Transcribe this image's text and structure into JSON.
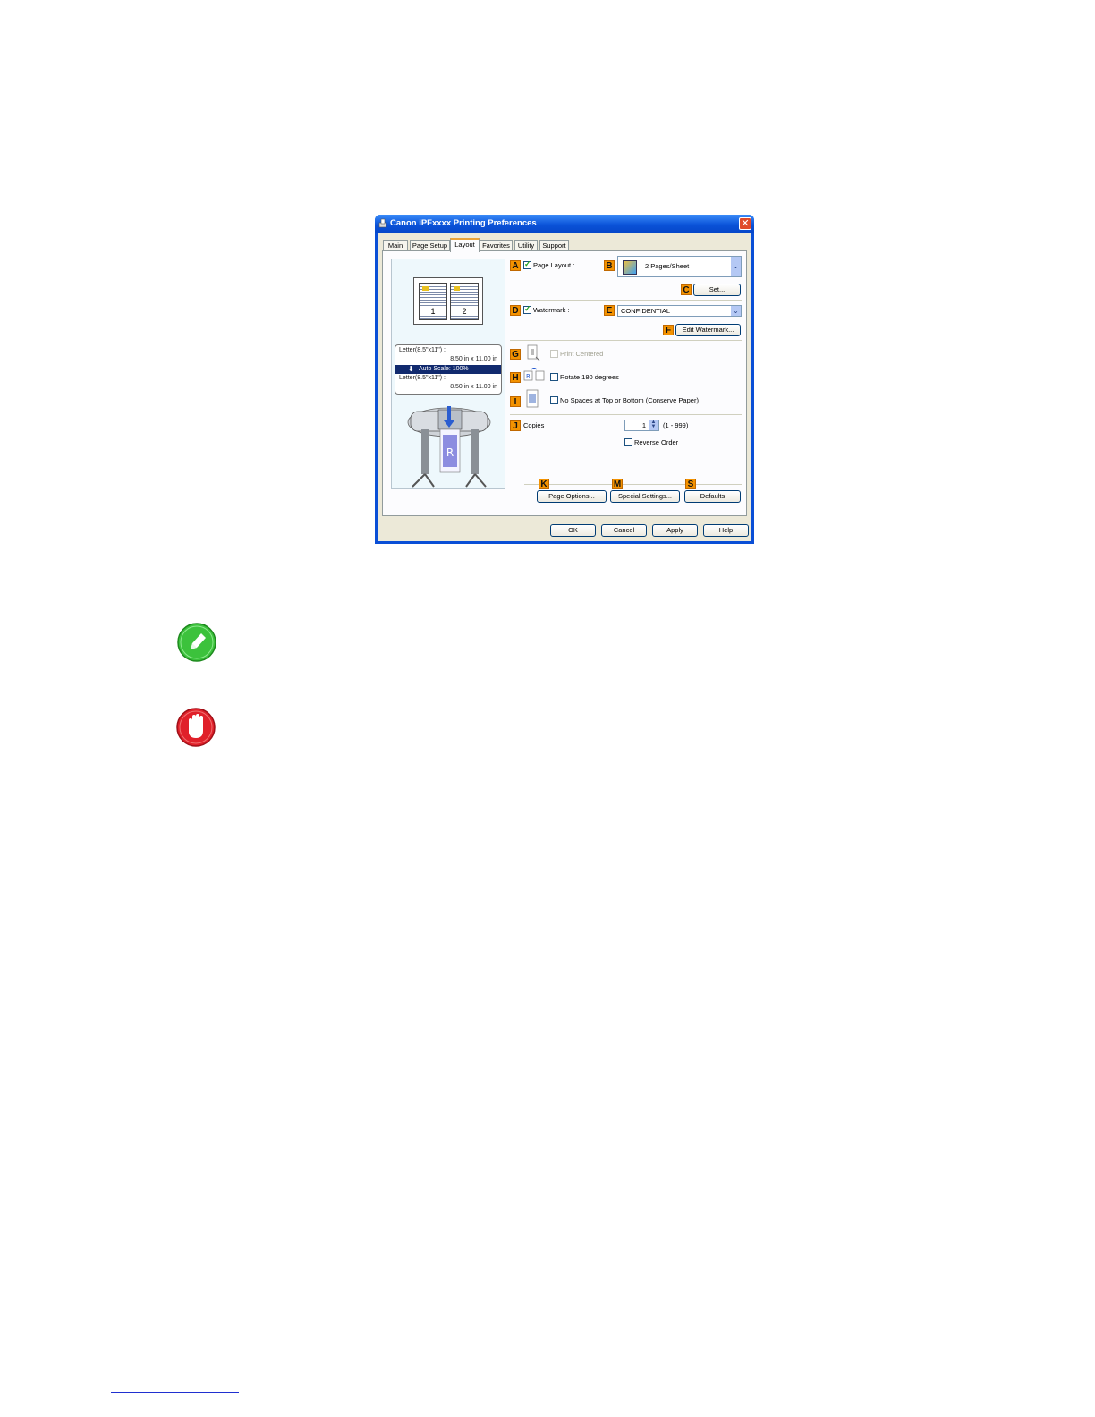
{
  "dialog": {
    "title": "Canon iPFxxxx Printing Preferences",
    "close_label": "✕",
    "tabs": [
      {
        "label": "Main",
        "active": false
      },
      {
        "label": "Page Setup",
        "active": false
      },
      {
        "label": "Layout",
        "active": true
      },
      {
        "label": "Favorites",
        "active": false
      },
      {
        "label": "Utility",
        "active": false
      },
      {
        "label": "Support",
        "active": false
      }
    ],
    "preview": {
      "page_numbers": [
        "1",
        "2"
      ],
      "info_line1": "Letter(8.5\"x11\") :",
      "info_line2": "8.50 in x 11.00 in",
      "info_scale": "Auto Scale: 100%",
      "info_line3": "Letter(8.5\"x11\") :",
      "info_line4": "8.50 in x 11.00 in"
    },
    "badges": {
      "A": "A",
      "B": "B",
      "C": "C",
      "D": "D",
      "E": "E",
      "F": "F",
      "G": "G",
      "H": "H",
      "I": "I",
      "J": "J",
      "K": "K",
      "M": "M",
      "S": "S"
    },
    "page_layout": {
      "label": "Page Layout :",
      "checked": true,
      "value": "2 Pages/Sheet",
      "set_button": "Set..."
    },
    "watermark": {
      "label": "Watermark :",
      "checked": true,
      "value": "CONFIDENTIAL",
      "edit_button": "Edit Watermark..."
    },
    "print_centered": {
      "label": "Print Centered",
      "checked": false,
      "disabled": true
    },
    "rotate": {
      "label": "Rotate 180 degrees",
      "checked": false
    },
    "no_spaces": {
      "label": "No Spaces at Top or Bottom (Conserve Paper)",
      "checked": false
    },
    "copies": {
      "label": "Copies :",
      "value": "1",
      "range": "(1 - 999)",
      "reverse_label": "Reverse Order",
      "reverse_checked": false
    },
    "bottom_buttons": {
      "page_options": "Page Options...",
      "special_settings": "Special Settings...",
      "defaults": "Defaults"
    },
    "footer_buttons": {
      "ok": "OK",
      "cancel": "Cancel",
      "apply": "Apply",
      "help": "Help"
    }
  },
  "icons": {
    "note": "pencil-note-icon",
    "important": "stop-hand-icon"
  },
  "colors": {
    "badge": "#f39200",
    "titlebar": "#0a52d8",
    "note_green": "#3cc23c",
    "stop_red": "#e0202a"
  }
}
